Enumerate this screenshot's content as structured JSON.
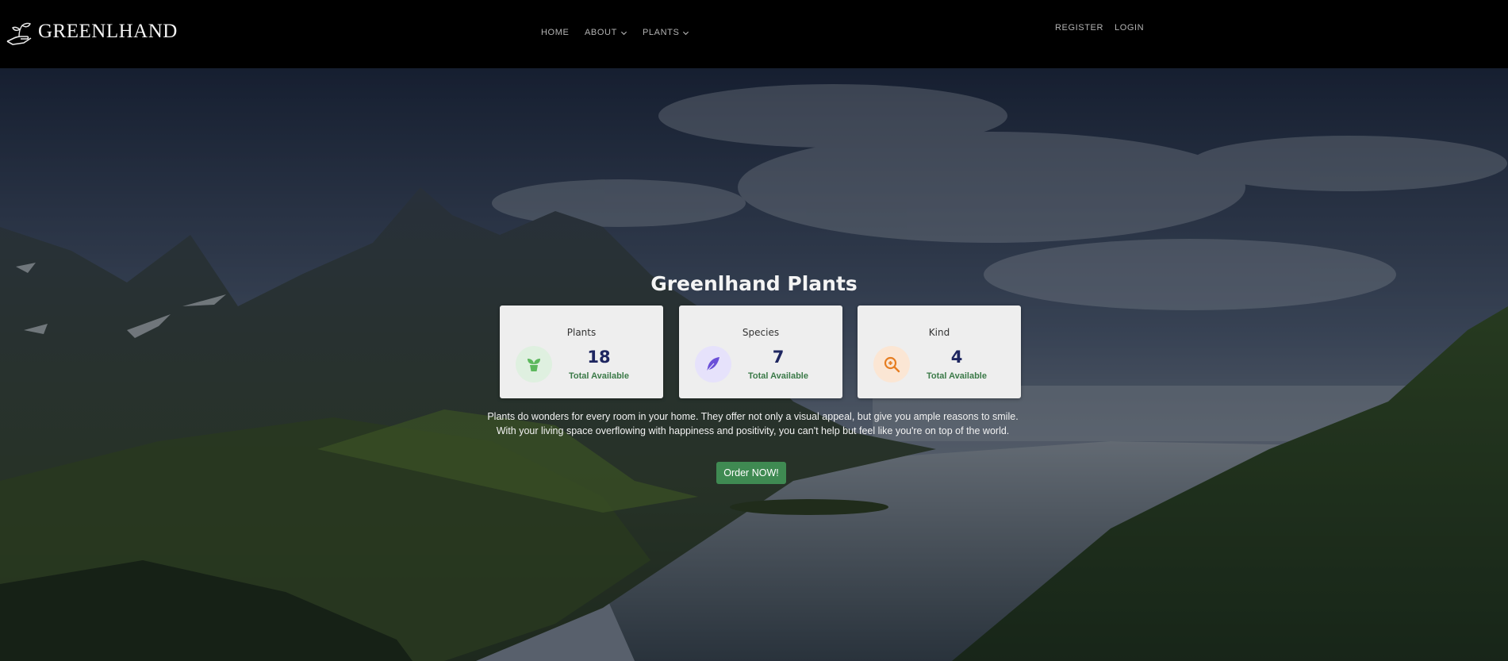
{
  "brand": {
    "name": "GREENLHAND",
    "icon": "hand-plant-logo-icon"
  },
  "nav": {
    "items": [
      {
        "label": "HOME"
      },
      {
        "label": "ABOUT",
        "icon": "chevron-down-icon"
      },
      {
        "label": "PLANTS",
        "icon": "chevron-down-icon"
      }
    ],
    "auth": [
      {
        "label": "REGISTER"
      },
      {
        "label": "LOGIN"
      }
    ]
  },
  "hero": {
    "title": "Greenlhand Plants",
    "background": "mountain-fjord-landscape",
    "description": "Plants do wonders for every room in your home. They offer not only a visual appeal, but give you ample reasons to smile. With your living space overflowing with happiness and positivity, you can't help but feel like you're on top of the world.",
    "cta_label": "Order NOW!"
  },
  "stats": [
    {
      "label": "Plants",
      "count": "18",
      "sub": "Total Available",
      "icon": "sprout-icon",
      "icon_color": "#5cb85c",
      "icon_bg": "#dff0e0"
    },
    {
      "label": "Species",
      "count": "7",
      "sub": "Total Available",
      "icon": "feather-icon",
      "icon_color": "#6a4fd8",
      "icon_bg": "#e6e2fb"
    },
    {
      "label": "Kind",
      "count": "4",
      "sub": "Total Available",
      "icon": "search-zoom-icon",
      "icon_color": "#e67e22",
      "icon_bg": "#fbe6d4"
    }
  ],
  "colors": {
    "navbar_bg": "#000000",
    "accent_green": "#3f8a52",
    "count_navy": "#1e2660",
    "card_bg": "#eeeeee"
  }
}
